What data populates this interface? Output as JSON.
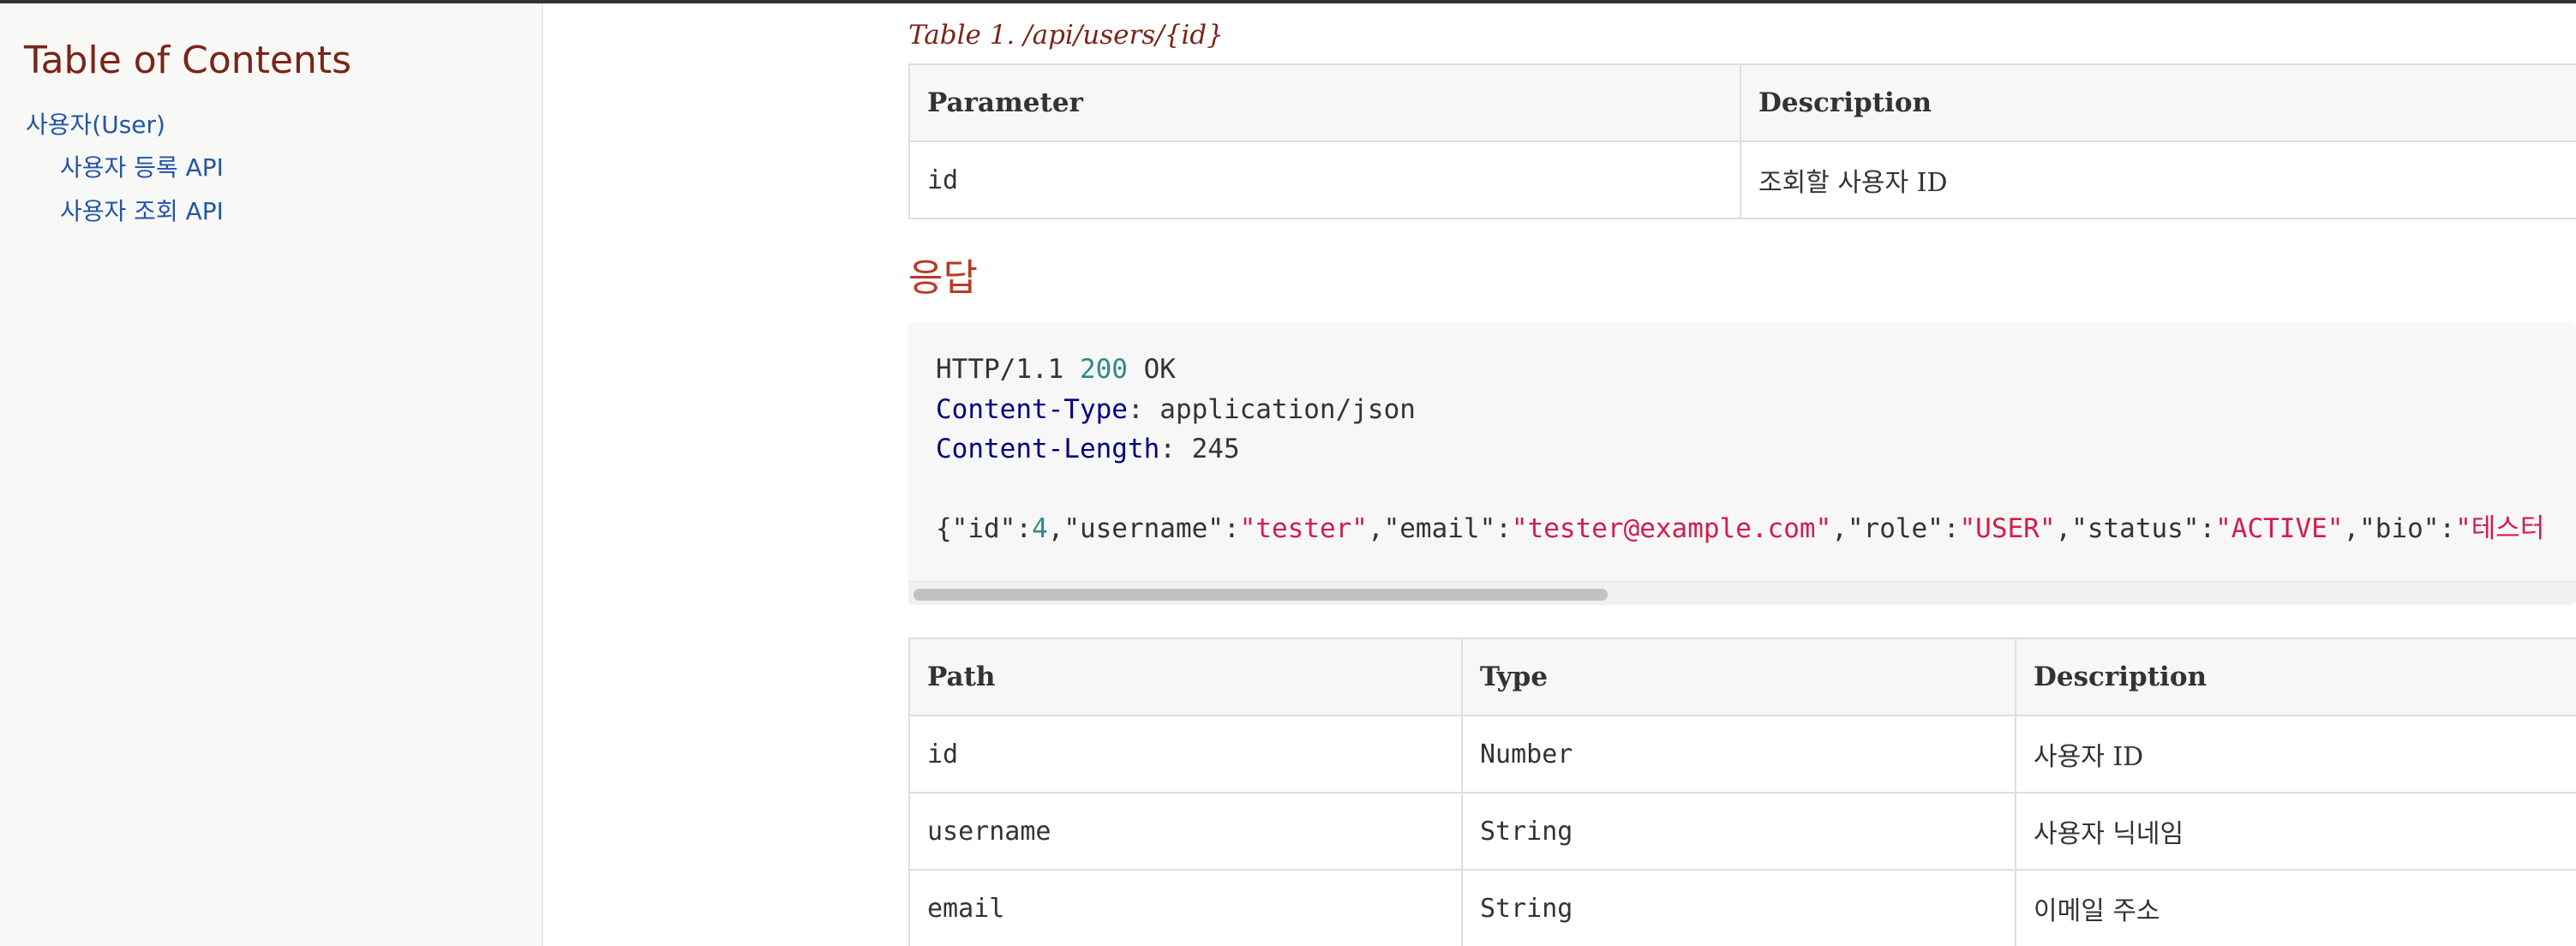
{
  "sidebar": {
    "title": "Table of Contents",
    "items": [
      {
        "label": "사용자(User)"
      },
      {
        "label": "사용자 등록 API"
      },
      {
        "label": "사용자 조회 API"
      }
    ]
  },
  "main": {
    "params_caption": "Table 1. /api/users/{id}",
    "params_table": {
      "headers": [
        "Parameter",
        "Description"
      ],
      "rows": [
        [
          "id",
          "조회할 사용자 ID"
        ]
      ]
    },
    "response_heading": "응답",
    "code": {
      "status_prefix": "HTTP/1.1 ",
      "status_code": "200",
      "status_text": " OK",
      "header1_name": "Content-Type",
      "header1_value": ": application/json",
      "header2_name": "Content-Length",
      "header2_sep": ": ",
      "header2_value": "245",
      "json_open": "{\"id\":",
      "json_id": "4",
      "json_k_username": ",\"username\":",
      "json_v_username": "\"tester\"",
      "json_k_email": ",\"email\":",
      "json_v_email": "\"tester@example.com\"",
      "json_k_role": ",\"role\":",
      "json_v_role": "\"USER\"",
      "json_k_status": ",\"status\":",
      "json_v_status": "\"ACTIVE\"",
      "json_k_bio": ",\"bio\":",
      "json_v_bio": "\"테스터"
    },
    "fields_table": {
      "headers": [
        "Path",
        "Type",
        "Description"
      ],
      "rows": [
        [
          "id",
          "Number",
          "사용자 ID"
        ],
        [
          "username",
          "String",
          "사용자 닉네임"
        ],
        [
          "email",
          "String",
          "이메일 주소"
        ]
      ]
    }
  },
  "colors": {
    "link": "#2156a5",
    "heading": "#ba3925",
    "caption": "#7a2518",
    "string_token": "#d21e4a",
    "number_token": "#2f8a87",
    "attr_token": "#000080"
  },
  "icons": []
}
